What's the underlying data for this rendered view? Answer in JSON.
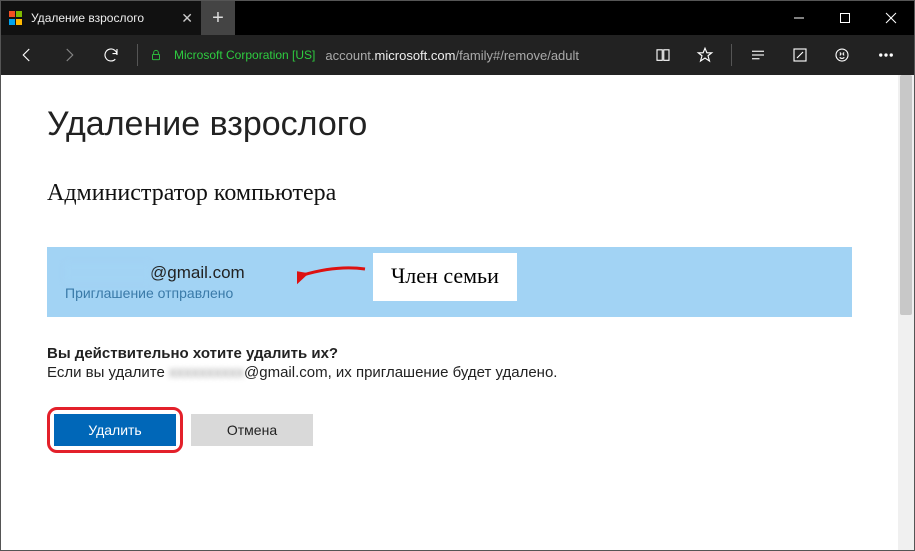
{
  "tab": {
    "title": "Удаление взрослого"
  },
  "securesite": "Microsoft Corporation [US]",
  "url_prefix": "account.",
  "url_host": "microsoft.com",
  "url_path": "/family#/remove/adult",
  "page": {
    "heading": "Удаление взрослого",
    "admin_annotation": "Администратор компьютера",
    "member": {
      "email_hidden": "xxxxxxxxxx",
      "email_domain": "@gmail.com",
      "status": "Приглашение отправлено",
      "family_label": "Член семьи"
    },
    "confirm_question": "Вы действительно хотите удалить их?",
    "confirm_text_prefix": "Если вы удалите ",
    "confirm_text_hidden": "xxxxxxxxxx",
    "confirm_text_mid": "@gmail.com, их приглашение будет удалено.",
    "btn_remove": "Удалить",
    "btn_cancel": "Отмена"
  }
}
